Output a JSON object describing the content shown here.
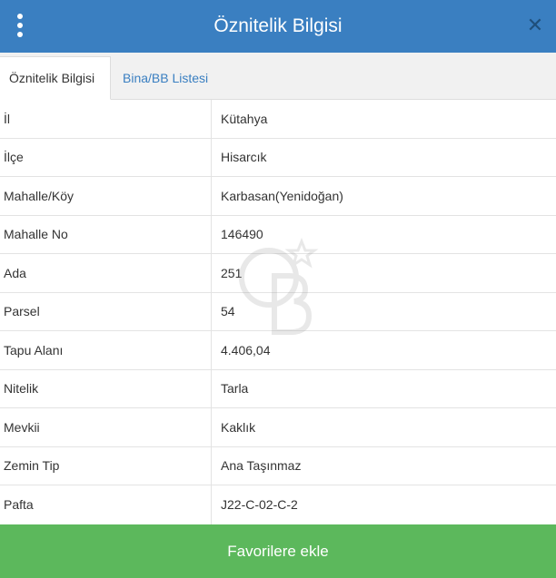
{
  "header": {
    "title": "Öznitelik Bilgisi",
    "menu_icon": "kebab-menu-icon",
    "close_icon": "close-icon"
  },
  "tabs": [
    {
      "label": "Öznitelik Bilgisi",
      "active": true
    },
    {
      "label": "Bina/BB Listesi",
      "active": false
    }
  ],
  "rows": [
    {
      "label": "İl",
      "value": "Kütahya"
    },
    {
      "label": "İlçe",
      "value": "Hisarcık"
    },
    {
      "label": "Mahalle/Köy",
      "value": "Karbasan(Yenidoğan)"
    },
    {
      "label": "Mahalle No",
      "value": "146490"
    },
    {
      "label": "Ada",
      "value": "251"
    },
    {
      "label": "Parsel",
      "value": "54"
    },
    {
      "label": "Tapu Alanı",
      "value": "4.406,04"
    },
    {
      "label": "Nitelik",
      "value": "Tarla"
    },
    {
      "label": "Mevkii",
      "value": "Kaklık"
    },
    {
      "label": "Zemin Tip",
      "value": "Ana Taşınmaz"
    },
    {
      "label": "Pafta",
      "value": "J22-C-02-C-2"
    }
  ],
  "footer": {
    "button_label": "Favorilere ekle"
  },
  "colors": {
    "header_bg": "#3a7fc1",
    "footer_bg": "#5cb85c",
    "tab_link": "#3a7fc1"
  }
}
